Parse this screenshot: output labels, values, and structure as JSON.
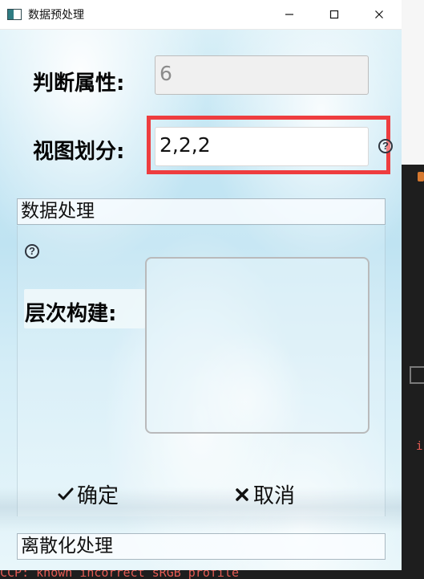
{
  "window": {
    "title": "数据预处理",
    "controls": {
      "minimize_icon": "minimize-icon",
      "maximize_icon": "maximize-icon",
      "close_icon": "close-icon"
    }
  },
  "form": {
    "judge_attribute": {
      "label": "判断属性:",
      "value": "6",
      "disabled": true
    },
    "view_partition": {
      "label": "视图划分:",
      "value": "2,2,2",
      "help_icon": "question-circle-icon",
      "highlight_color": "#ee3d3f"
    }
  },
  "sections": {
    "data_processing": {
      "title": "数据处理",
      "help_icon": "question-circle-icon",
      "hierarchy_label": "层次构建:",
      "hierarchy_text": ""
    },
    "discretization": {
      "title": "离散化处理"
    }
  },
  "actions": {
    "confirm": {
      "label": "确定",
      "icon": "check-icon"
    },
    "cancel": {
      "label": "取消",
      "icon": "close-icon"
    }
  },
  "background_terminal": {
    "bottom_text": "CCP: known incorrect sRGB profile",
    "right_partial_text": "i"
  },
  "colors": {
    "highlight": "#ee3d3f",
    "window_background": "#bfe3f2",
    "disabled_input": "#f0f0f0"
  }
}
